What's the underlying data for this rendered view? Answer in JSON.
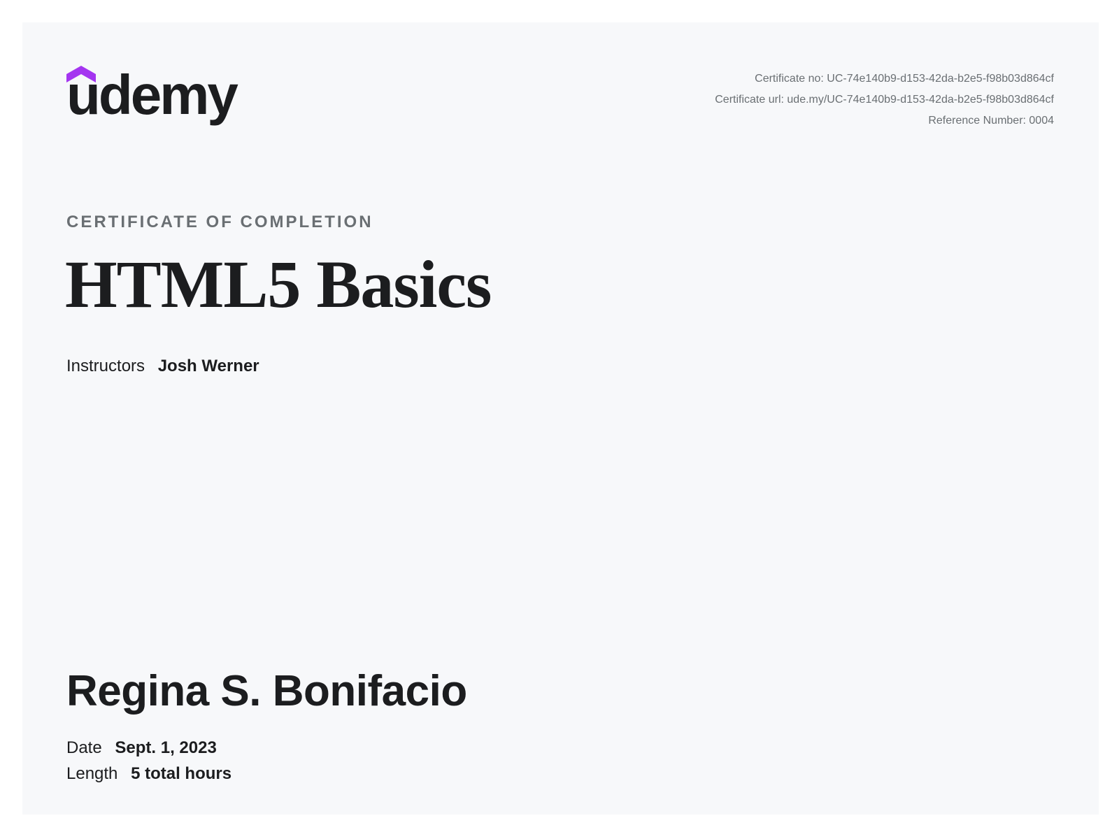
{
  "brand": {
    "logo_text": "udemy",
    "accent_color": "#a435f0"
  },
  "meta": {
    "certificate_no": "Certificate no: UC-74e140b9-d153-42da-b2e5-f98b03d864cf",
    "certificate_url": "Certificate url: ude.my/UC-74e140b9-d153-42da-b2e5-f98b03d864cf",
    "reference_number": "Reference Number: 0004"
  },
  "certificate": {
    "label": "CERTIFICATE OF COMPLETION",
    "course_title": "HTML5 Basics",
    "instructors_label": "Instructors",
    "instructors": "Josh Werner",
    "recipient": "Regina S. Bonifacio",
    "date_label": "Date",
    "date": "Sept. 1, 2023",
    "length_label": "Length",
    "length": "5 total hours"
  }
}
